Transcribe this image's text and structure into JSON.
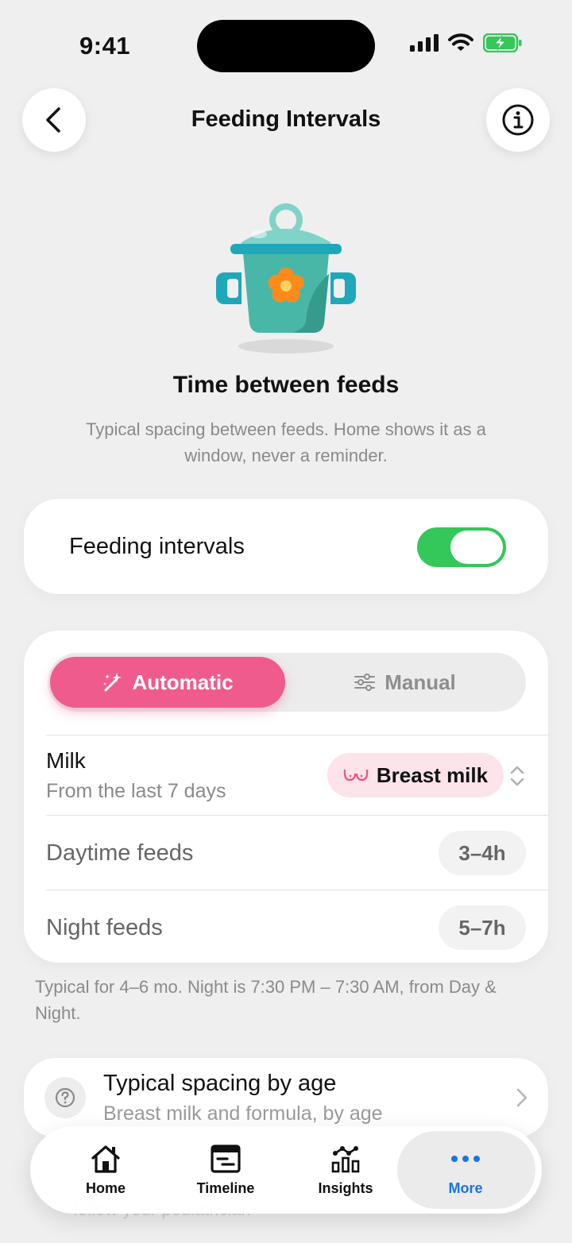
{
  "status_bar": {
    "time": "9:41"
  },
  "header": {
    "title": "Feeding Intervals"
  },
  "hero": {
    "title": "Time between feeds",
    "subtitle": "Typical spacing between feeds. Home shows it as a window, never a reminder."
  },
  "toggle": {
    "label": "Feeding intervals",
    "enabled": true,
    "accent": "#34c759"
  },
  "mode": {
    "options": [
      "Automatic",
      "Manual"
    ],
    "selected": "Automatic",
    "accent": "#f05b8e"
  },
  "milk": {
    "title": "Milk",
    "subtitle": "From the last 7 days",
    "selected": "Breast milk"
  },
  "rows": [
    {
      "label": "Daytime feeds",
      "value": "3–4h"
    },
    {
      "label": "Night feeds",
      "value": "5–7h"
    }
  ],
  "footnote": "Typical for 4–6 mo. Night is 7:30 PM – 7:30 AM, from Day & Night.",
  "spacing_card": {
    "title": "Typical spacing by age",
    "subtitle": "Breast milk and formula, by age"
  },
  "partial_text": "follow your pediatrician",
  "tabs": [
    {
      "label": "Home",
      "icon": "house-icon"
    },
    {
      "label": "Timeline",
      "icon": "timeline-icon"
    },
    {
      "label": "Insights",
      "icon": "insights-icon"
    },
    {
      "label": "More",
      "icon": "more-icon",
      "active": true
    }
  ],
  "active_tab_color": "#1a73e8"
}
